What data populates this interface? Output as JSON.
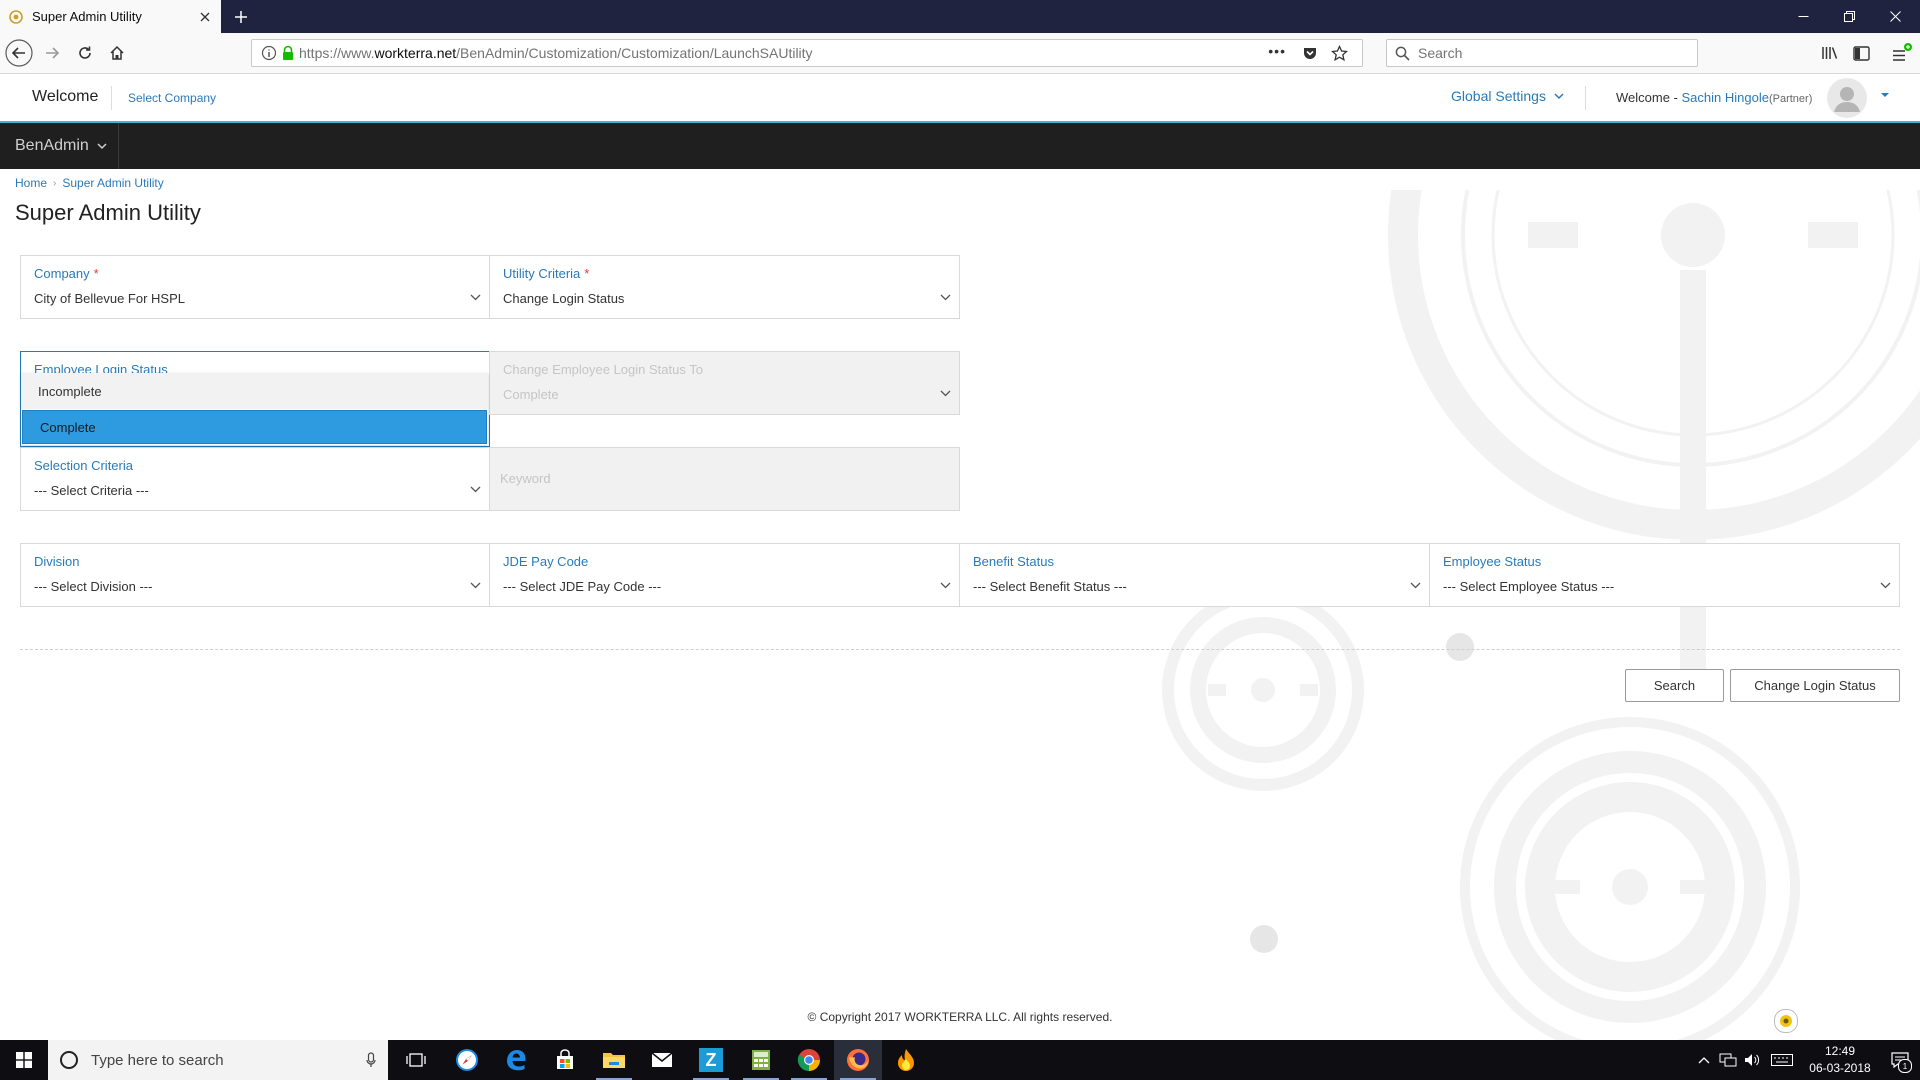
{
  "browser": {
    "tab_title": "Super Admin Utility",
    "url_prefix": "https://www.",
    "url_host": "workterra.net",
    "url_path": "/BenAdmin/Customization/Customization/LaunchSAUtility",
    "search_placeholder": "Search",
    "page_actions_label": "•••"
  },
  "header": {
    "welcome": "Welcome",
    "select_company": "Select Company",
    "global_settings": "Global Settings",
    "welcome_prefix": "Welcome -",
    "user_name": "Sachin Hingole",
    "user_role": "(Partner)"
  },
  "nav": {
    "menu_label": "BenAdmin"
  },
  "breadcrumb": {
    "home": "Home",
    "current": "Super Admin Utility"
  },
  "page": {
    "title": "Super Admin Utility"
  },
  "form": {
    "company": {
      "label": "Company",
      "required_mark": "*",
      "value": "City of Bellevue For HSPL"
    },
    "utility_criteria": {
      "label": "Utility Criteria",
      "required_mark": "*",
      "value": "Change Login Status"
    },
    "employee_login_status": {
      "label": "Employee Login Status",
      "options": [
        "Incomplete",
        "Complete"
      ],
      "highlighted": "Complete"
    },
    "change_login_status_to": {
      "label": "Change Employee Login Status To",
      "value": "Complete"
    },
    "selection_criteria": {
      "label": "Selection Criteria",
      "value": "--- Select Criteria ---"
    },
    "keyword": {
      "placeholder": "Keyword"
    },
    "division": {
      "label": "Division",
      "value": "--- Select Division ---"
    },
    "jde_pay_code": {
      "label": "JDE Pay Code",
      "value": "--- Select JDE Pay Code ---"
    },
    "benefit_status": {
      "label": "Benefit Status",
      "value": "--- Select Benefit Status ---"
    },
    "employee_status": {
      "label": "Employee Status",
      "value": "--- Select Employee Status ---"
    }
  },
  "actions": {
    "search": "Search",
    "change_login_status": "Change Login Status"
  },
  "footer": {
    "copyright": "© Copyright 2017 WORKTERRA LLC. All rights reserved."
  },
  "taskbar": {
    "search_placeholder": "Type here to search",
    "time": "12:49",
    "date": "06-03-2018",
    "notification_count": "1",
    "z_app_letter": "Z"
  },
  "colors": {
    "link_blue": "#2a7ab8",
    "header_accent": "#4ab0d9",
    "nav_dark": "#1f1f1f",
    "dropdown_highlight": "#2e9be0",
    "required_red": "#e53935"
  }
}
